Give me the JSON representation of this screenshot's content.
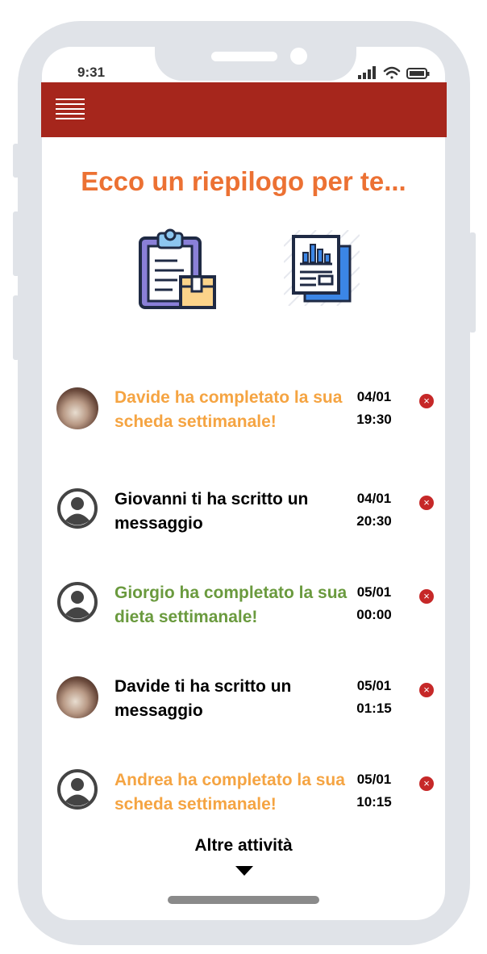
{
  "status_bar": {
    "time": "9:31"
  },
  "header": {
    "menu_icon": "hamburger-icon",
    "color": "#a6261c"
  },
  "title": "Ecco un riepilogo per te...",
  "shortcuts": [
    {
      "icon": "clipboard-package-icon"
    },
    {
      "icon": "report-document-icon"
    }
  ],
  "activities": [
    {
      "avatar": "photo",
      "text": "Davide ha completato la sua scheda settimanale!",
      "color": "#f5a442",
      "date": "04/01",
      "time": "19:30"
    },
    {
      "avatar": "default",
      "text": "Giovanni ti ha scritto un messaggio",
      "color": "#000000",
      "date": "04/01",
      "time": "20:30"
    },
    {
      "avatar": "default",
      "text": "Giorgio ha completato la sua dieta settimanale!",
      "color": "#6a9a3e",
      "date": "05/01",
      "time": "00:00"
    },
    {
      "avatar": "photo",
      "text": "Davide ti ha scritto un messaggio",
      "color": "#000000",
      "date": "05/01",
      "time": "01:15"
    },
    {
      "avatar": "default",
      "text": "Andrea ha completato la sua scheda settimanale!",
      "color": "#f5a442",
      "date": "05/01",
      "time": "10:15"
    }
  ],
  "more_label": "Altre attività"
}
